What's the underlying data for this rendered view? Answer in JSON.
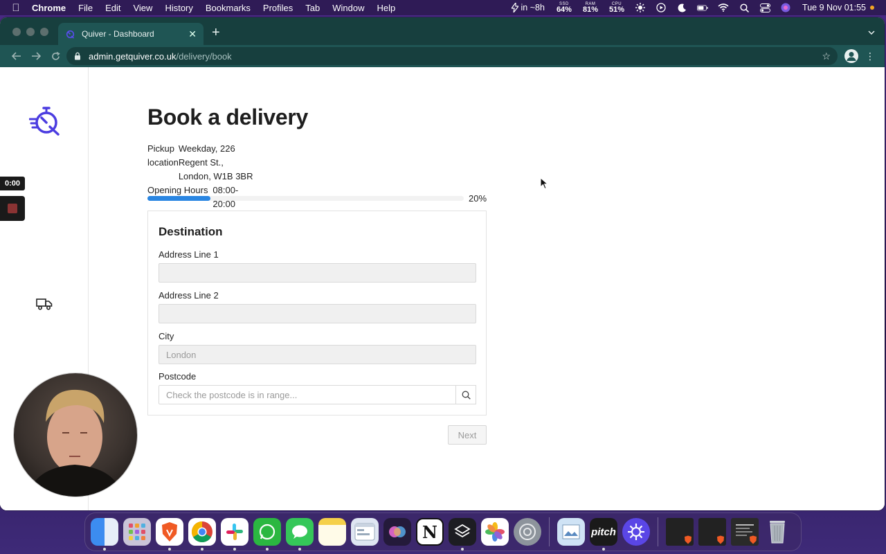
{
  "menubar": {
    "app_name": "Chrome",
    "items": [
      "File",
      "Edit",
      "View",
      "History",
      "Bookmarks",
      "Profiles",
      "Tab",
      "Window",
      "Help"
    ],
    "status_timer": "in ~8h",
    "ssd": {
      "key": "SSD",
      "value": "64%"
    },
    "ram": {
      "key": "RAM",
      "value": "81%"
    },
    "cpu": {
      "key": "CPU",
      "value": "51%"
    },
    "clock": "Tue 9 Nov  01:55"
  },
  "browser": {
    "tab_title": "Quiver - Dashboard",
    "url_host": "admin.getquiver.co.uk",
    "url_path": "/delivery/book"
  },
  "page": {
    "title": "Book a delivery",
    "pickup_label": "Pickup location",
    "pickup_value": "Weekday, 226 Regent St., London, W1B 3BR",
    "hours_label": "Opening Hours",
    "hours_value": "08:00-20:00",
    "progress_percent": 20,
    "progress_label": "20%",
    "form": {
      "section_title": "Destination",
      "address1_label": "Address Line 1",
      "address1_value": "",
      "address2_label": "Address Line 2",
      "address2_value": "",
      "city_label": "City",
      "city_placeholder": "London",
      "postcode_label": "Postcode",
      "postcode_placeholder": "Check the postcode is in range..."
    },
    "next_label": "Next"
  },
  "recorder": {
    "timer": "0:00"
  },
  "colors": {
    "progress": "#2a86e2",
    "brand": "#4b3ce0",
    "chrome_frame": "#173f3e"
  },
  "dock": {
    "apps": [
      "Finder",
      "Launchpad",
      "Brave",
      "Chrome",
      "Slack",
      "WhatsApp",
      "Messages",
      "Notes",
      "Finder window",
      "Siri",
      "Notion",
      "Layers",
      "Photos",
      "System Preferences",
      "Preview",
      "Pitch",
      "Pixelmator",
      "Brave window",
      "Brave window",
      "Document",
      "Trash"
    ]
  }
}
